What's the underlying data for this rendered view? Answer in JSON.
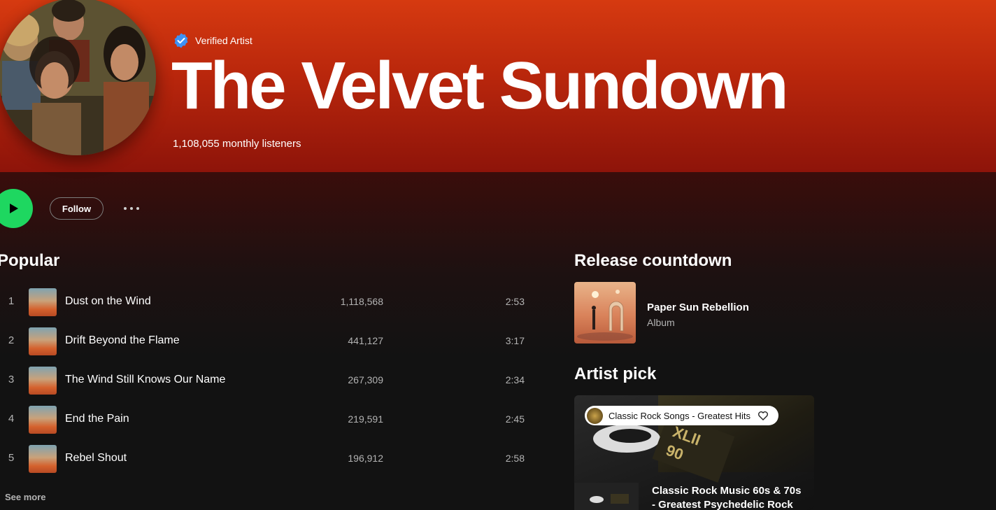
{
  "artist": {
    "verified_label": "Verified Artist",
    "name": "The Velvet Sundown",
    "monthly_listeners": "1,108,055 monthly listeners"
  },
  "actions": {
    "follow_label": "Follow"
  },
  "popular": {
    "title": "Popular",
    "tracks": [
      {
        "rank": "1",
        "title": "Dust on the Wind",
        "plays": "1,118,568",
        "duration": "2:53"
      },
      {
        "rank": "2",
        "title": "Drift Beyond the Flame",
        "plays": "441,127",
        "duration": "3:17"
      },
      {
        "rank": "3",
        "title": "The Wind Still Knows Our Name",
        "plays": "267,309",
        "duration": "2:34"
      },
      {
        "rank": "4",
        "title": "End the Pain",
        "plays": "219,591",
        "duration": "2:45"
      },
      {
        "rank": "5",
        "title": "Rebel Shout",
        "plays": "196,912",
        "duration": "2:58"
      }
    ],
    "see_more_label": "See more"
  },
  "release_countdown": {
    "title": "Release countdown",
    "release_title": "Paper Sun Rebellion",
    "release_type": "Album"
  },
  "artist_pick": {
    "title": "Artist pick",
    "pill_text": "Classic Rock Songs - Greatest Hits",
    "pick_title_line1": "Classic Rock Music 60s & 70s",
    "pick_title_line2": "- Greatest Psychedelic Rock"
  },
  "colors": {
    "hero_top": "#d63a10",
    "hero_bottom": "#8e140a",
    "play_green": "#1ed760",
    "verified_blue": "#3d91f4"
  }
}
